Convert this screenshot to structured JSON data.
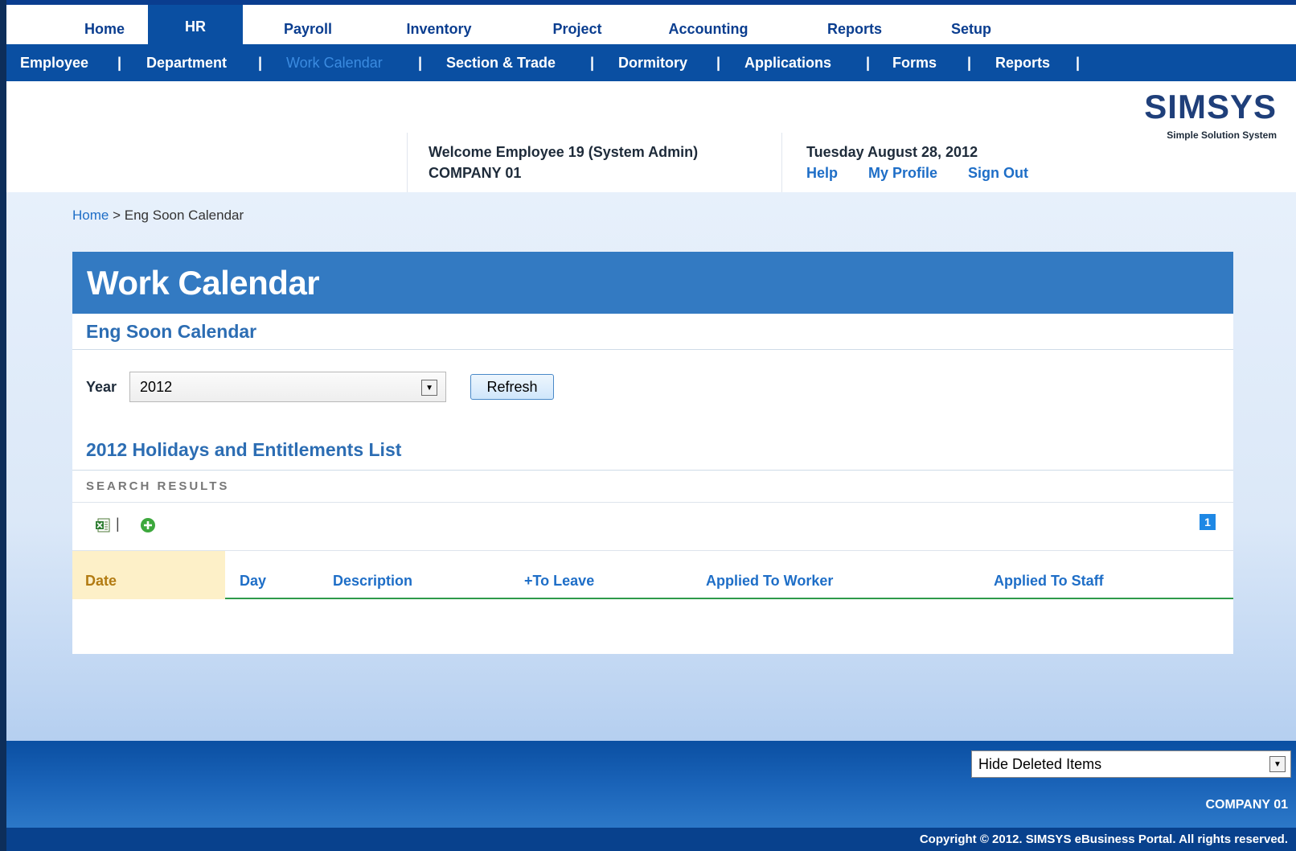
{
  "top_tabs": [
    {
      "label": "Home"
    },
    {
      "label": "HR"
    },
    {
      "label": "Payroll"
    },
    {
      "label": "Inventory"
    },
    {
      "label": "Project"
    },
    {
      "label": "Accounting"
    },
    {
      "label": "Reports"
    },
    {
      "label": "Setup"
    }
  ],
  "active_top_tab": "HR",
  "sub_nav": [
    {
      "label": "Employee"
    },
    {
      "label": "Department"
    },
    {
      "label": "Work Calendar"
    },
    {
      "label": "Section & Trade"
    },
    {
      "label": "Dormitory"
    },
    {
      "label": "Applications"
    },
    {
      "label": "Forms"
    },
    {
      "label": "Reports"
    }
  ],
  "sub_nav_separator": "|",
  "active_sub_nav": "Work Calendar",
  "header": {
    "welcome": "Welcome Employee 19 (System Admin)",
    "company": "COMPANY 01",
    "date": "Tuesday August 28, 2012",
    "links": {
      "help": "Help",
      "profile": "My Profile",
      "signout": "Sign Out"
    },
    "logo_text": "SIMSYS",
    "logo_sub": "Simple Solution System"
  },
  "breadcrumb": {
    "home": "Home",
    "separator": ">",
    "current": "Eng Soon Calendar"
  },
  "page": {
    "title": "Work Calendar",
    "subtitle": "Eng Soon Calendar",
    "year_label": "Year",
    "year_value": "2012",
    "refresh_label": "Refresh",
    "list_title": "2012  Holidays and Entitlements List",
    "search_results_label": "SEARCH RESULTS",
    "toolbar_separator": "|",
    "page_number": "1",
    "columns": [
      "Date",
      "Day",
      "Description",
      "+To Leave",
      "Applied To Worker",
      "Applied To Staff"
    ],
    "rows": []
  },
  "footer": {
    "filter_value": "Hide Deleted Items",
    "company": "COMPANY 01",
    "copyright": "Copyright © 2012. SIMSYS eBusiness Portal. All rights reserved."
  },
  "colors": {
    "nav_blue": "#0a4fa2",
    "title_bar": "#337ac2",
    "link_blue": "#1e6ec7",
    "date_col_bg": "#fdf0c8",
    "header_underline": "#2e9a4a"
  },
  "icons": [
    "excel-export-icon",
    "add-icon",
    "select-arrow-icon"
  ]
}
